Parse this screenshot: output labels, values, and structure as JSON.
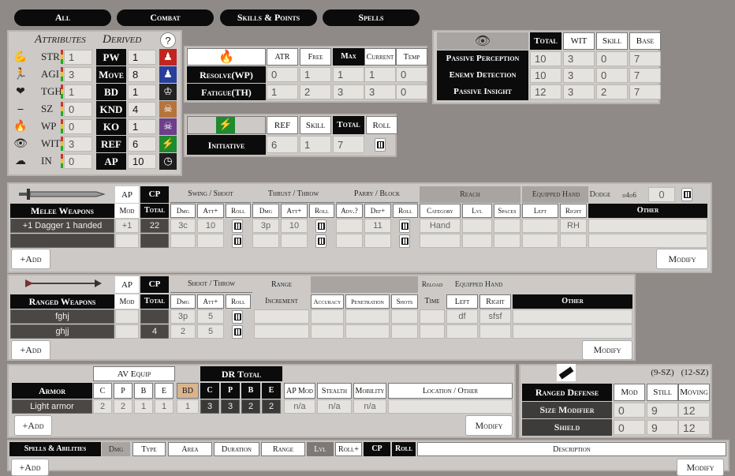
{
  "tabs": [
    "All",
    "Combat",
    "Skills & Points",
    "Spells"
  ],
  "attributes": {
    "header": "Attributes",
    "derived_header": "Derived",
    "help": "?",
    "rows": [
      {
        "label": "STR",
        "value": "1",
        "icon": "flexed-arm-icon"
      },
      {
        "label": "AGI",
        "value": "3",
        "icon": "running-figure-icon"
      },
      {
        "label": "TGH",
        "value": "1",
        "icon": "heart-cross-icon"
      },
      {
        "label": "SZ",
        "value": "0",
        "icon": "ruler-icon"
      },
      {
        "label": "WP",
        "value": "0",
        "icon": "flame-icon"
      },
      {
        "label": "WIT",
        "value": "3",
        "icon": "eye-icon"
      },
      {
        "label": "IN",
        "value": "0",
        "icon": "brain-icon"
      }
    ],
    "derived": [
      {
        "label": "PW",
        "value": "1",
        "icon": "red-figure-icon",
        "color": "#c0261f"
      },
      {
        "label": "Move",
        "value": "8",
        "icon": "blue-leg-icon",
        "color": "#2a3f9a"
      },
      {
        "label": "BD",
        "value": "1",
        "icon": "helmet-icon",
        "color": "#222222"
      },
      {
        "label": "KND",
        "value": "4",
        "icon": "knockdown-icon",
        "color": "#b5743c"
      },
      {
        "label": "KO",
        "value": "1",
        "icon": "skull-icon",
        "color": "#6d3f8a"
      },
      {
        "label": "REF",
        "value": "6",
        "icon": "lightning-icon",
        "color": "#1f8a2e"
      },
      {
        "label": "AP",
        "value": "10",
        "icon": "clock-icon",
        "color": "#1e1e1e"
      }
    ]
  },
  "resolve": {
    "headers": [
      "ATR",
      "Free",
      "Max",
      "Current",
      "Temp"
    ],
    "rows": [
      {
        "label": "Resolve(WP)",
        "values": [
          "0",
          "1",
          "1",
          "1",
          "0"
        ]
      },
      {
        "label": "Fatigue(TH)",
        "values": [
          "1",
          "2",
          "3",
          "3",
          "0"
        ]
      }
    ]
  },
  "initiative": {
    "headers": [
      "REF",
      "Skill",
      "Total",
      "Roll"
    ],
    "label": "Initiative",
    "values": [
      "6",
      "1",
      "7"
    ]
  },
  "passive": {
    "headers": [
      "Total",
      "WIT",
      "Skill",
      "Base"
    ],
    "rows": [
      {
        "label": "Passive Perception",
        "values": [
          "10",
          "3",
          "0",
          "7"
        ]
      },
      {
        "label": "Enemy Detection",
        "values": [
          "10",
          "3",
          "0",
          "7"
        ]
      },
      {
        "label": "Passive Insight",
        "values": [
          "12",
          "3",
          "2",
          "7"
        ]
      }
    ]
  },
  "melee": {
    "title": "Melee Weapons",
    "ap": "AP",
    "cp": "CP",
    "mod": "Mod",
    "total": "Total",
    "groups": [
      "Swing / Shoot",
      "Thrust / Throw",
      "Parry / Block",
      "Reach",
      "Equipped Hand"
    ],
    "dodge": "Dodge",
    "dodge_dice": "d4d6",
    "dodge_value": "0",
    "sub": [
      "Dmg",
      "Att+",
      "Roll",
      "Dmg",
      "Att+",
      "Roll",
      "Adv.?",
      "Def+",
      "Roll",
      "Category",
      "Lvl",
      "Spaces",
      "Left",
      "Right",
      "Other"
    ],
    "rows": [
      {
        "name": "+1 Dagger 1 handed",
        "mod": "+1",
        "total": "22",
        "sdmg": "3c",
        "satt": "10",
        "tdmg": "3p",
        "tatt": "10",
        "def": "11",
        "cat": "Hand",
        "right": "RH"
      },
      {
        "name": "",
        "mod": "",
        "total": "",
        "sdmg": "",
        "satt": "",
        "tdmg": "",
        "tatt": "",
        "def": "",
        "cat": "",
        "right": ""
      }
    ],
    "add": "+Add",
    "modify": "Modify"
  },
  "ranged": {
    "title": "Ranged Weapons",
    "ap": "AP",
    "cp": "CP",
    "mod": "Mod",
    "total": "Total",
    "shoot": "Shoot / Throw",
    "range": "Range",
    "increment": "Increment",
    "reload": "Reload",
    "time": "Time",
    "equipped": "Equipped Hand",
    "sub": [
      "Dmg",
      "Att+",
      "Roll",
      "Accuracy",
      "Penetration",
      "Shots",
      "Left",
      "Right",
      "Other"
    ],
    "rows": [
      {
        "name": "fghj",
        "total": "",
        "dmg": "3p",
        "att": "5",
        "left": "df",
        "right": "sfsf"
      },
      {
        "name": "ghjj",
        "total": "4",
        "dmg": "2",
        "att": "5",
        "left": "",
        "right": ""
      }
    ],
    "add": "+Add",
    "modify": "Modify"
  },
  "armor": {
    "title": "Armor",
    "av": "AV Equip",
    "dr": "DR Total",
    "cols": [
      "C",
      "P",
      "B",
      "E",
      "BD",
      "C",
      "P",
      "B",
      "E",
      "AP Mod",
      "Stealth",
      "Mobility",
      "Location / Other"
    ],
    "row": {
      "name": "Light armor",
      "av": [
        "2",
        "2",
        "1",
        "1",
        "1"
      ],
      "dr": [
        "3",
        "3",
        "2",
        "2"
      ],
      "ap": "n/a",
      "stealth": "n/a",
      "mobility": "n/a"
    },
    "add": "+Add",
    "modify": "Modify"
  },
  "defense": {
    "title": "Ranged Defense",
    "hdr1": "(9-SZ)",
    "hdr2": "(12-SZ)",
    "cols": [
      "Mod",
      "Still",
      "Moving"
    ],
    "rows": [
      {
        "label": "Size Modifier",
        "values": [
          "0",
          "9",
          "12"
        ]
      },
      {
        "label": "Shield",
        "values": [
          "0",
          "9",
          "12"
        ]
      }
    ]
  },
  "spells": {
    "cols": [
      "Spells & Abilities",
      "Dmg",
      "Type",
      "Area",
      "Duration",
      "Range",
      "Lvl",
      "Roll+",
      "CP",
      "Roll",
      "Description"
    ],
    "add": "+Add",
    "modify": "Modify"
  }
}
